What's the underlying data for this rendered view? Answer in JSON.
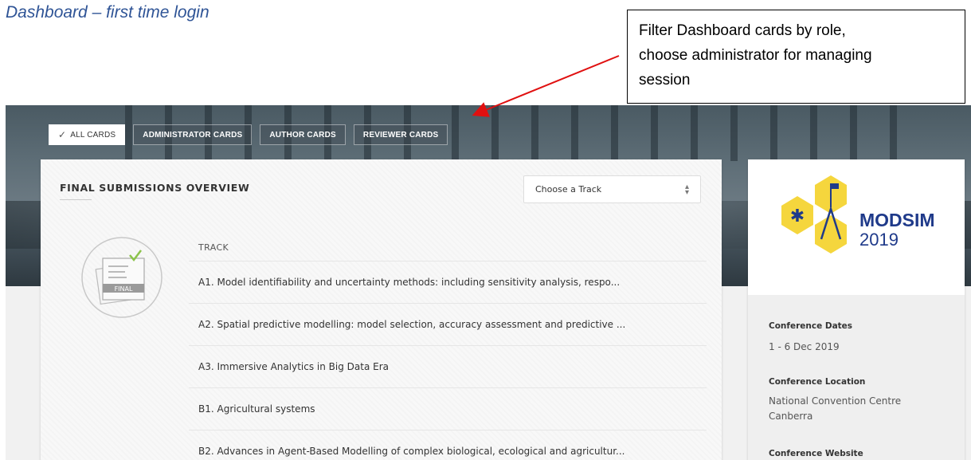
{
  "doc": {
    "heading": "Dashboard – first time login",
    "callout_lines": [
      "Filter Dashboard cards by role,",
      "choose administrator for managing",
      "session"
    ]
  },
  "filters": [
    {
      "label": "ALL CARDS",
      "active": true
    },
    {
      "label": "ADMINISTRATOR CARDS",
      "active": false
    },
    {
      "label": "AUTHOR CARDS",
      "active": false
    },
    {
      "label": "REVIEWER CARDS",
      "active": false
    }
  ],
  "submissions_card": {
    "title": "FINAL SUBMISSIONS OVERVIEW",
    "select_placeholder": "Choose a Track",
    "badge_label": "FINAL",
    "track_header": "TRACK",
    "tracks": [
      "A1. Model identifiability and uncertainty methods: including sensitivity analysis, respo...",
      "A2. Spatial predictive modelling: model selection, accuracy assessment and predictive ...",
      "A3. Immersive Analytics in Big Data Era",
      "B1. Agricultural systems",
      "B2. Advances in Agent-Based Modelling of complex biological, ecological and agricultur..."
    ]
  },
  "conference": {
    "logo_text": "MODSIM",
    "logo_year": "2019",
    "dates_label": "Conference Dates",
    "dates_value": "1 - 6 Dec 2019",
    "location_label": "Conference Location",
    "location_line1": "National Convention Centre",
    "location_line2": "Canberra",
    "website_label": "Conference Website"
  },
  "colors": {
    "heading": "#2f5496",
    "arrow": "#e01010",
    "logo_yellow": "#f5d63d",
    "logo_navy": "#1f3a8a",
    "check_green": "#8bc34a"
  }
}
